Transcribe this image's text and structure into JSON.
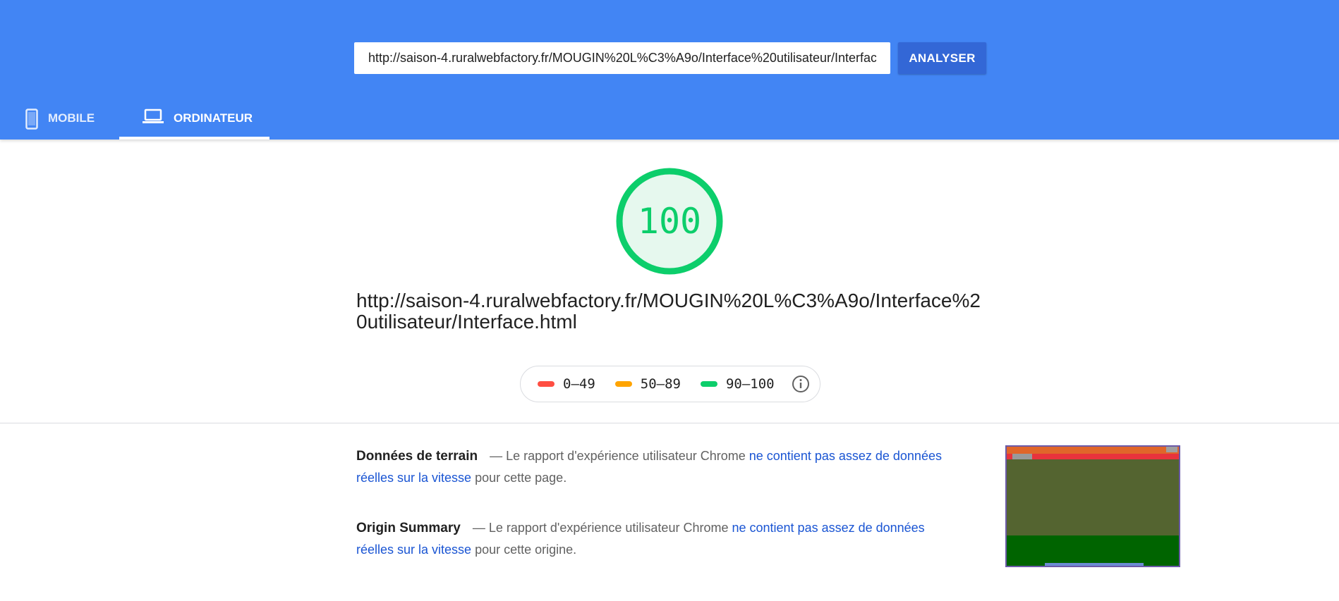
{
  "header": {
    "url_value": "http://saison-4.ruralwebfactory.fr/MOUGIN%20L%C3%A9o/Interface%20utilisateur/Interface.html",
    "analyze_label": "ANALYSER",
    "tabs": [
      {
        "label": "MOBILE",
        "icon": "smartphone-icon",
        "selected": false
      },
      {
        "label": "ORDINATEUR",
        "icon": "laptop-icon",
        "selected": true
      }
    ],
    "color": "#4285f4"
  },
  "score": {
    "value": "100",
    "color": "#0cce6b"
  },
  "tested_url": "http://saison-4.ruralwebfactory.fr/MOUGIN%20L%C3%A9o/Interface%20utilisateur/Interface.html",
  "legend": {
    "items": [
      {
        "label": "0–49",
        "color": "#ff4e42"
      },
      {
        "label": "50–89",
        "color": "#ffa400"
      },
      {
        "label": "90–100",
        "color": "#0cce6b"
      }
    ],
    "info_icon": "info-icon"
  },
  "field_data": {
    "title": "Données de terrain",
    "prefix": "— Le rapport d'expérience utilisateur Chrome",
    "link": "ne contient pas assez de données réelles sur la vitesse",
    "suffix": "pour cette page."
  },
  "origin_summary": {
    "title": "Origin Summary",
    "prefix": "— Le rapport d'expérience utilisateur Chrome",
    "link": "ne contient pas assez de données réelles sur la vitesse",
    "suffix": "pour cette origine."
  }
}
